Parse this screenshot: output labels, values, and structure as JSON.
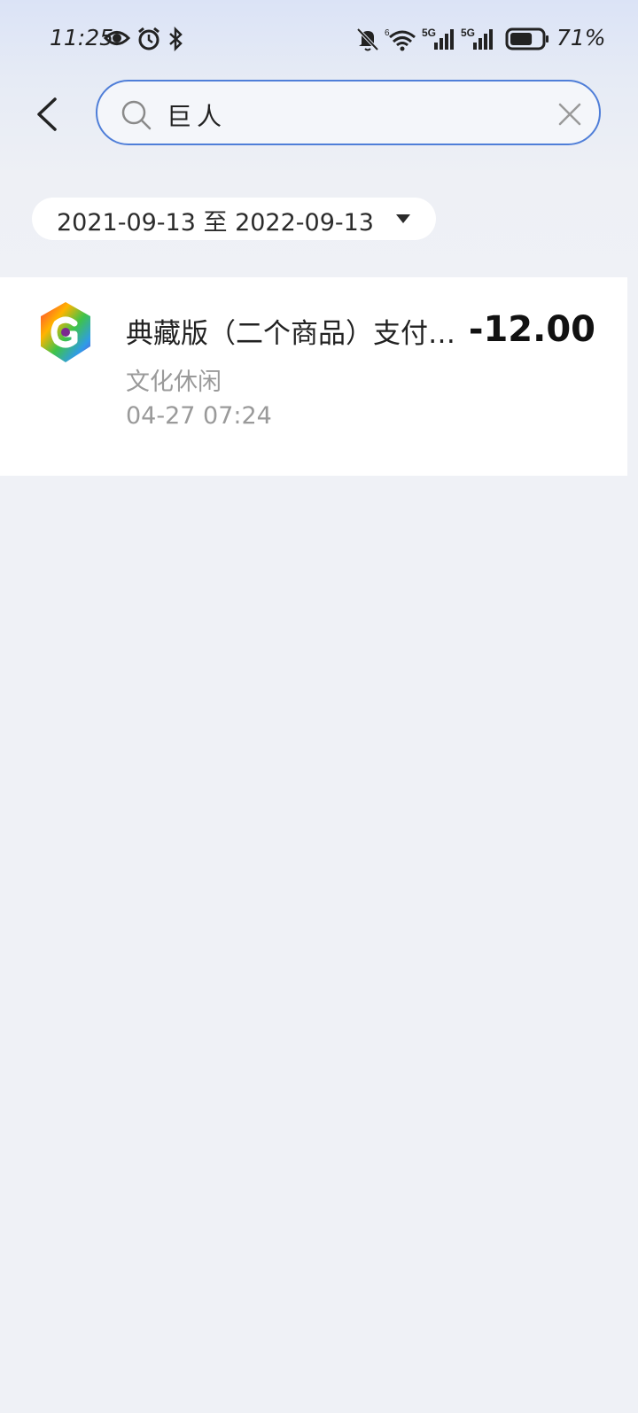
{
  "status_bar": {
    "time": "11:25",
    "battery_percent_text": "71%",
    "battery_level": 0.71,
    "icons": [
      "eye-icon",
      "alarm-icon",
      "bluetooth-icon",
      "mute-bell-icon",
      "wifi-icon",
      "signal-5g-icon",
      "signal-5g-icon",
      "battery-icon"
    ]
  },
  "header": {
    "back_icon": "chevron-left-icon",
    "search": {
      "value": "巨人",
      "icon": "search-icon",
      "clear_icon": "close-icon",
      "border_color": "#4f7ed8"
    }
  },
  "filter": {
    "date_range": "2021-09-13 至 2022-09-13",
    "caret_icon": "caret-down-icon"
  },
  "transactions": [
    {
      "title": "典藏版（二个商品）支付…",
      "amount": "-12.00",
      "category": "文化休闲",
      "time": "04-27 07:24",
      "logo_icon": "app-logo-icon"
    }
  ],
  "colors": {
    "background": "#eff1f6",
    "card": "#ffffff",
    "accent": "#4f7ed8",
    "secondary_text": "#9a9a9a"
  }
}
